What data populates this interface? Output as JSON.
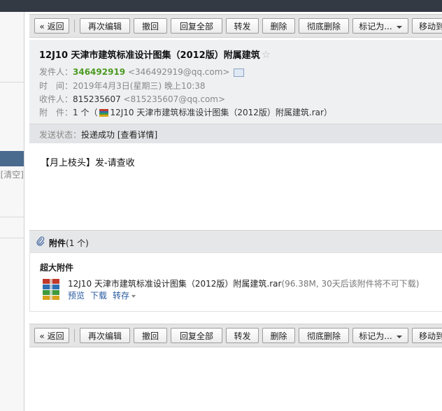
{
  "toolbar": {
    "back": "« 返回",
    "reedit": "再次编辑",
    "recall": "撤回",
    "reply_all": "回复全部",
    "forward": "转发",
    "delete": "删除",
    "delete_forever": "彻底删除",
    "mark_as": "标记为...",
    "move_to": "移动到"
  },
  "sidebar": {
    "clear_text": "[清空]"
  },
  "mail": {
    "subject": "12J10 天津市建筑标准设计图集（2012版）附属建筑",
    "star": "☆",
    "from_label": "发件人：",
    "from_name": "346492919",
    "from_addr": "<346492919@qq.com>",
    "time_label": "时　间：",
    "time_value": "2019年4月3日(星期三) 晚上10:38",
    "to_label": "收件人：",
    "to_addr_full": "815235607 <815235607@qq.com>",
    "to_name": "815235607",
    "to_addr": "<815235607@qq.com>",
    "attach_label": "附　件：",
    "attach_prefix": "1 个（",
    "attach_name": "12J10 天津市建筑标准设计图集（2012版）附属建筑.rar",
    "attach_suffix": "）",
    "status_label": "发送状态：",
    "status_value": "投递成功",
    "status_link": "[查看详情]",
    "body": "【月上枝头】发-请查收"
  },
  "attachments": {
    "heading": "附件",
    "count": "(1 个)",
    "big_label": "超大附件",
    "file_name": "12J10 天津市建筑标准设计图集（2012版）附属建筑.rar",
    "file_info": "(96.38M, 30天后该附件将不可下载)",
    "preview": "预览",
    "download": "下载",
    "save": "转存"
  },
  "colors": {
    "sender": "#4b9a20",
    "link": "#2a5aa0",
    "topbar": "#333a44",
    "sidebar_selected": "#4a6a8e"
  },
  "icons": [
    "star-icon",
    "vcard-icon",
    "rar-file-icon",
    "paperclip-icon",
    "dropdown-caret-icon"
  ]
}
